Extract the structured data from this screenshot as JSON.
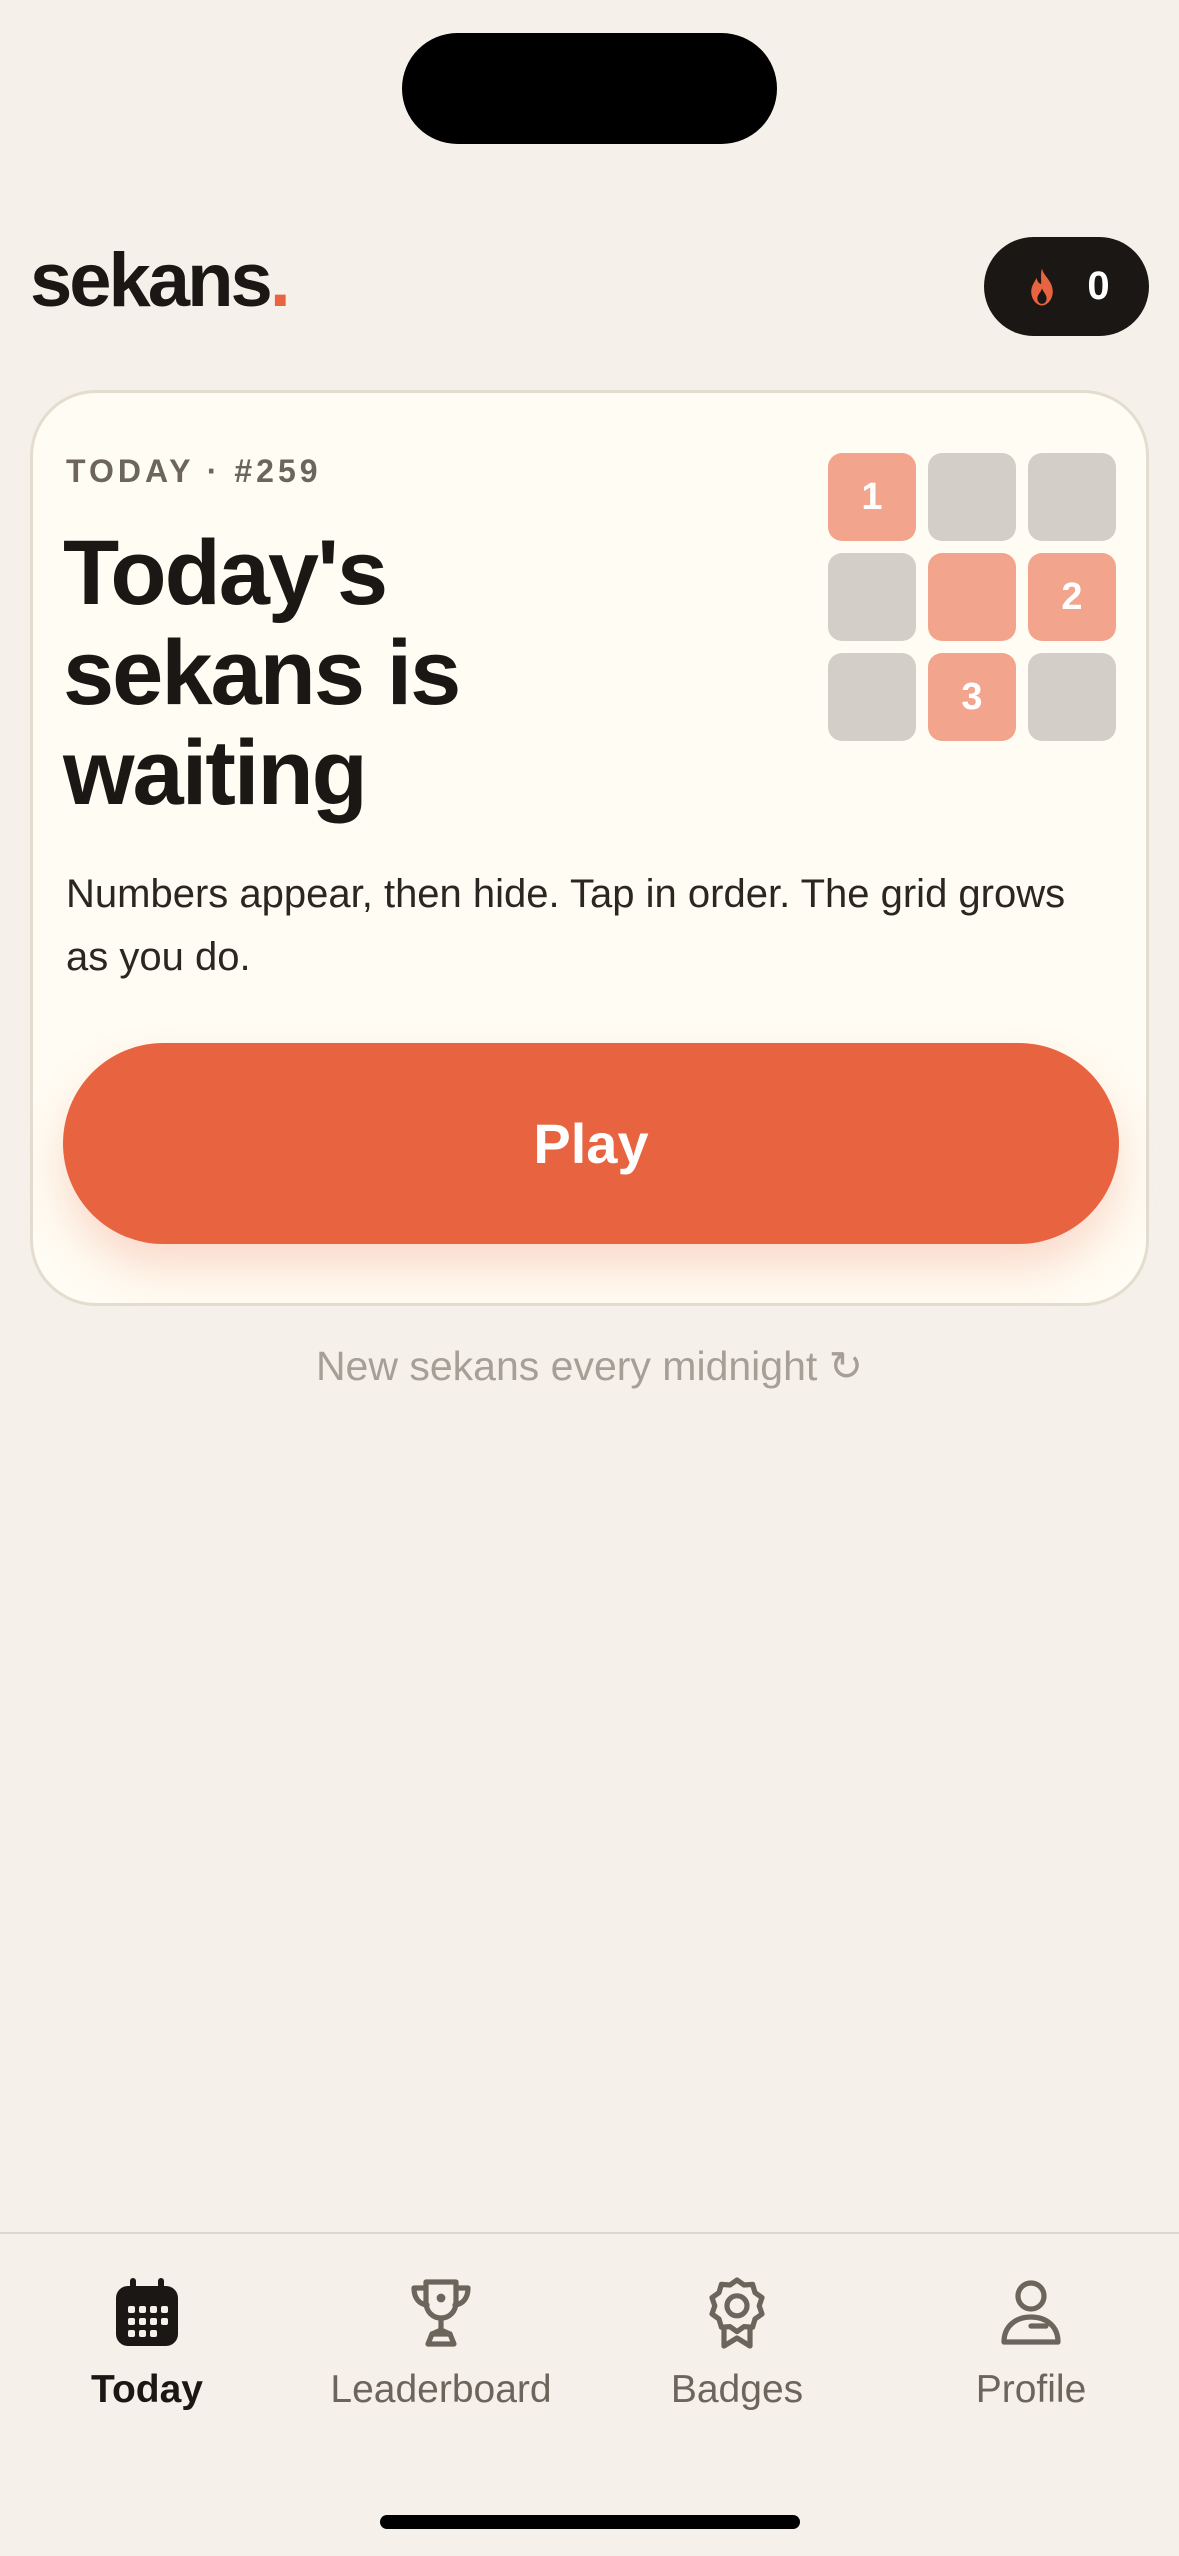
{
  "app": {
    "logo_text": "sekans",
    "logo_dot": ".",
    "accent_color": "#e8633f"
  },
  "streak": {
    "icon": "flame-icon",
    "count": "0"
  },
  "card": {
    "eyebrow": "TODAY · #259",
    "headline_lines": [
      "Today's",
      "sekans is",
      "waiting"
    ],
    "description": "Numbers appear, then hide. Tap in order. The grid grows as you do.",
    "play_label": "Play",
    "grid": [
      {
        "label": "1",
        "lit": true
      },
      {
        "label": "",
        "lit": false
      },
      {
        "label": "",
        "lit": false
      },
      {
        "label": "",
        "lit": false
      },
      {
        "label": "",
        "lit": true
      },
      {
        "label": "2",
        "lit": true
      },
      {
        "label": "",
        "lit": false
      },
      {
        "label": "3",
        "lit": true
      },
      {
        "label": "",
        "lit": false
      }
    ]
  },
  "refresh_note": "New sekans every midnight ↻",
  "tabbar": {
    "items": [
      {
        "label": "Today",
        "icon": "calendar-icon",
        "active": true
      },
      {
        "label": "Leaderboard",
        "icon": "trophy-icon",
        "active": false
      },
      {
        "label": "Badges",
        "icon": "badge-icon",
        "active": false
      },
      {
        "label": "Profile",
        "icon": "profile-icon",
        "active": false
      }
    ]
  }
}
